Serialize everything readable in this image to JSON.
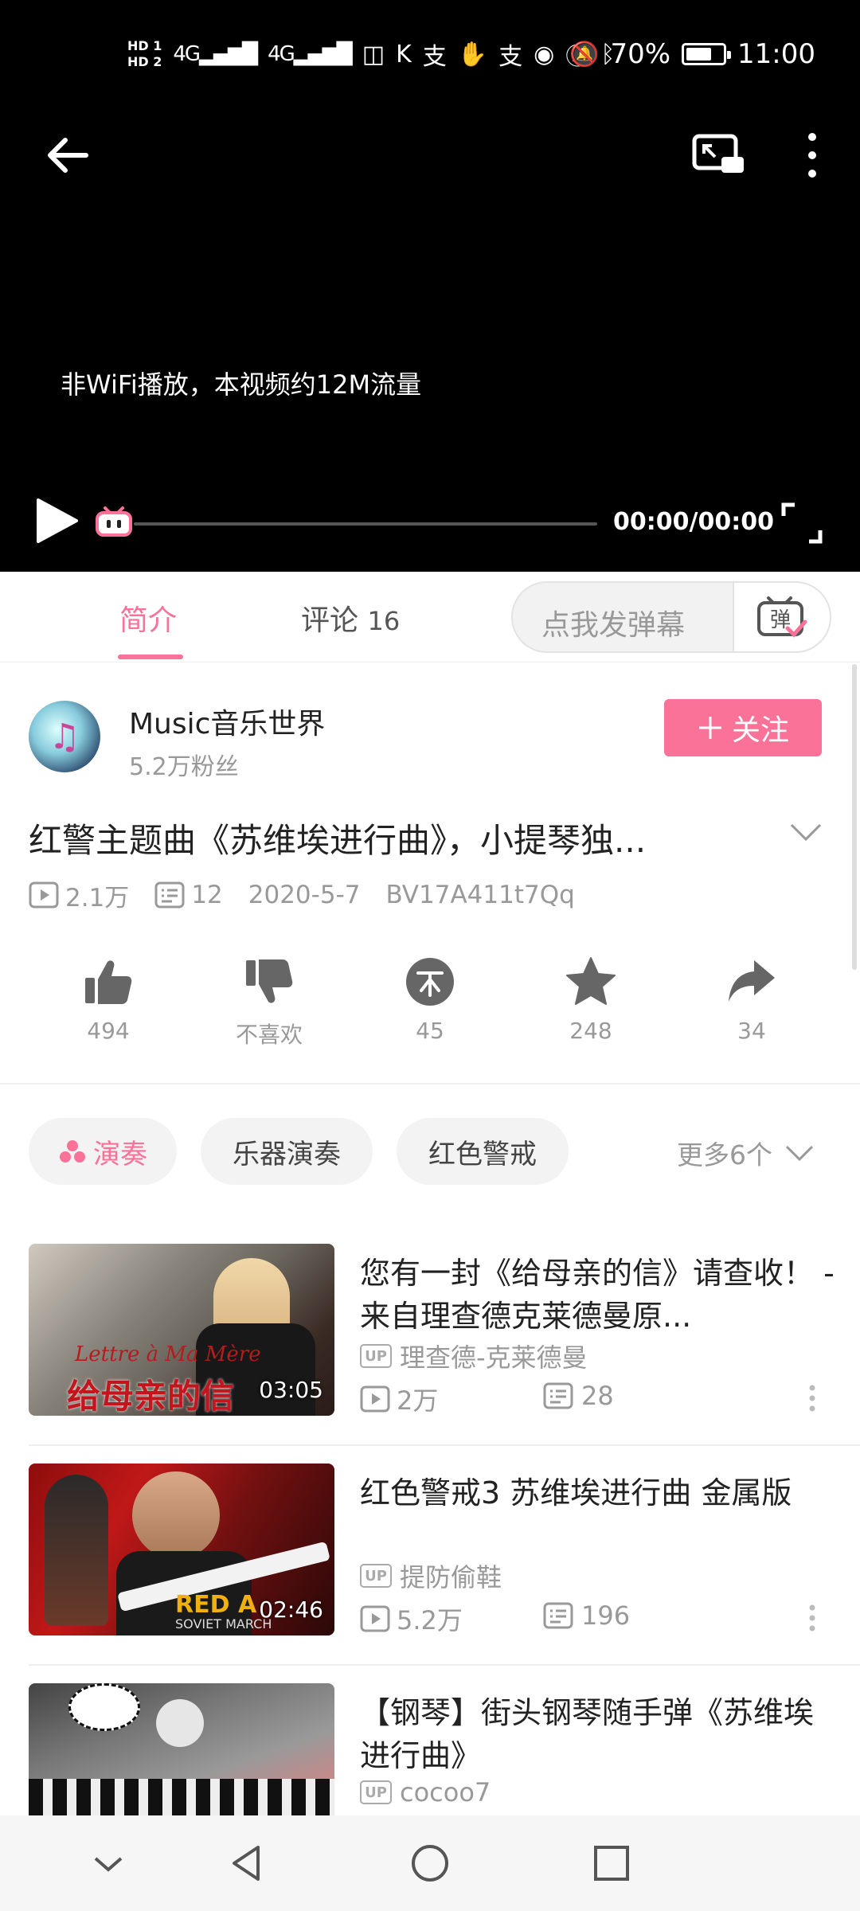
{
  "status_bar": {
    "hd1": "HD 1",
    "hd2": "HD 2",
    "signal1": "4G",
    "signal2": "4G",
    "battery_percent": "70%",
    "battery_level": 0.7,
    "time": "11:00"
  },
  "player": {
    "notice": "非WiFi播放，本视频约12M流量",
    "time": "00:00/00:00",
    "progress": 0
  },
  "tabs": {
    "intro": "简介",
    "comments_label": "评论",
    "comments_count": "16",
    "danmaku_placeholder": "点我发弹幕",
    "danmaku_button": "弹"
  },
  "uploader": {
    "name": "Music音乐世界",
    "fans": "5.2万粉丝",
    "follow_label": "关注"
  },
  "video": {
    "title": "红警主题曲《苏维埃进行曲》，小提琴独...",
    "views": "2.1万",
    "danmaku_count": "12",
    "date": "2020-5-7",
    "bvid": "BV17A411t7Qq"
  },
  "actions": {
    "like": "494",
    "dislike": "不喜欢",
    "coin": "45",
    "favorite": "248",
    "share": "34"
  },
  "tags": {
    "items": [
      "演奏",
      "乐器演奏",
      "红色警戒"
    ],
    "more": "更多6个"
  },
  "related": [
    {
      "title": "您有一封《给母亲的信》请查收！ -来自理查德克莱德曼原...",
      "duration": "03:05",
      "author": "理查德-克莱德曼",
      "plays": "2万",
      "danmaku": "28",
      "thumb_caption_top": "Lettre à Ma Mère",
      "thumb_caption_main": "给母亲的信"
    },
    {
      "title": "红色警戒3 苏维埃进行曲 金属版",
      "duration": "02:46",
      "author": "提防偷鞋",
      "plays": "5.2万",
      "danmaku": "196",
      "thumb_caption_top": "RED A",
      "thumb_caption_main": "SOVIET MARCH"
    },
    {
      "title": "【钢琴】街头钢琴随手弹《苏维埃进行曲》",
      "author": "cocoo7"
    }
  ],
  "colors": {
    "accent": "#fb7299",
    "muted": "#999999"
  }
}
